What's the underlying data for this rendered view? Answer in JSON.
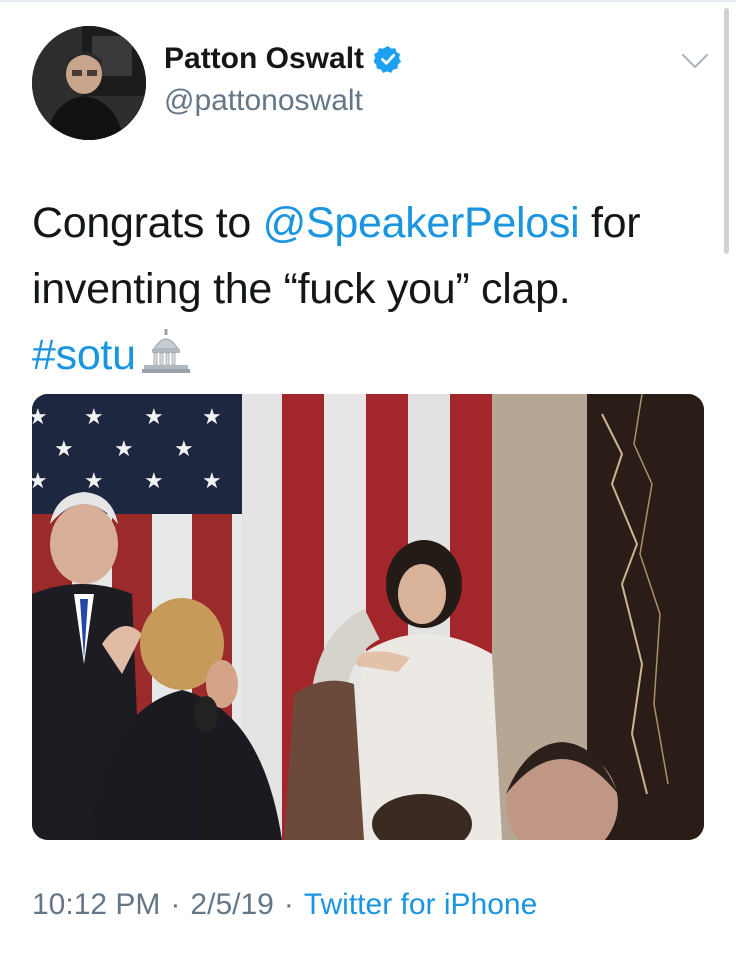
{
  "user": {
    "name": "Patton Oswalt",
    "handle": "@pattonoswalt",
    "verified": true,
    "avatar_icon": "profile-photo"
  },
  "tweet": {
    "text_before": "Congrats to ",
    "mention": "@SpeakerPelosi",
    "text_after": " for inventing the “fuck you” clap.",
    "hashtag": "#sotu",
    "emoji_icon": "capitol-building-icon"
  },
  "meta": {
    "time": "10:12 PM",
    "sep1": "·",
    "date": "2/5/19",
    "sep2": "·",
    "source": "Twitter for iPhone"
  },
  "colors": {
    "link": "#1b95e0",
    "secondary_text": "#657786",
    "verified_badge": "#1da1f2"
  }
}
